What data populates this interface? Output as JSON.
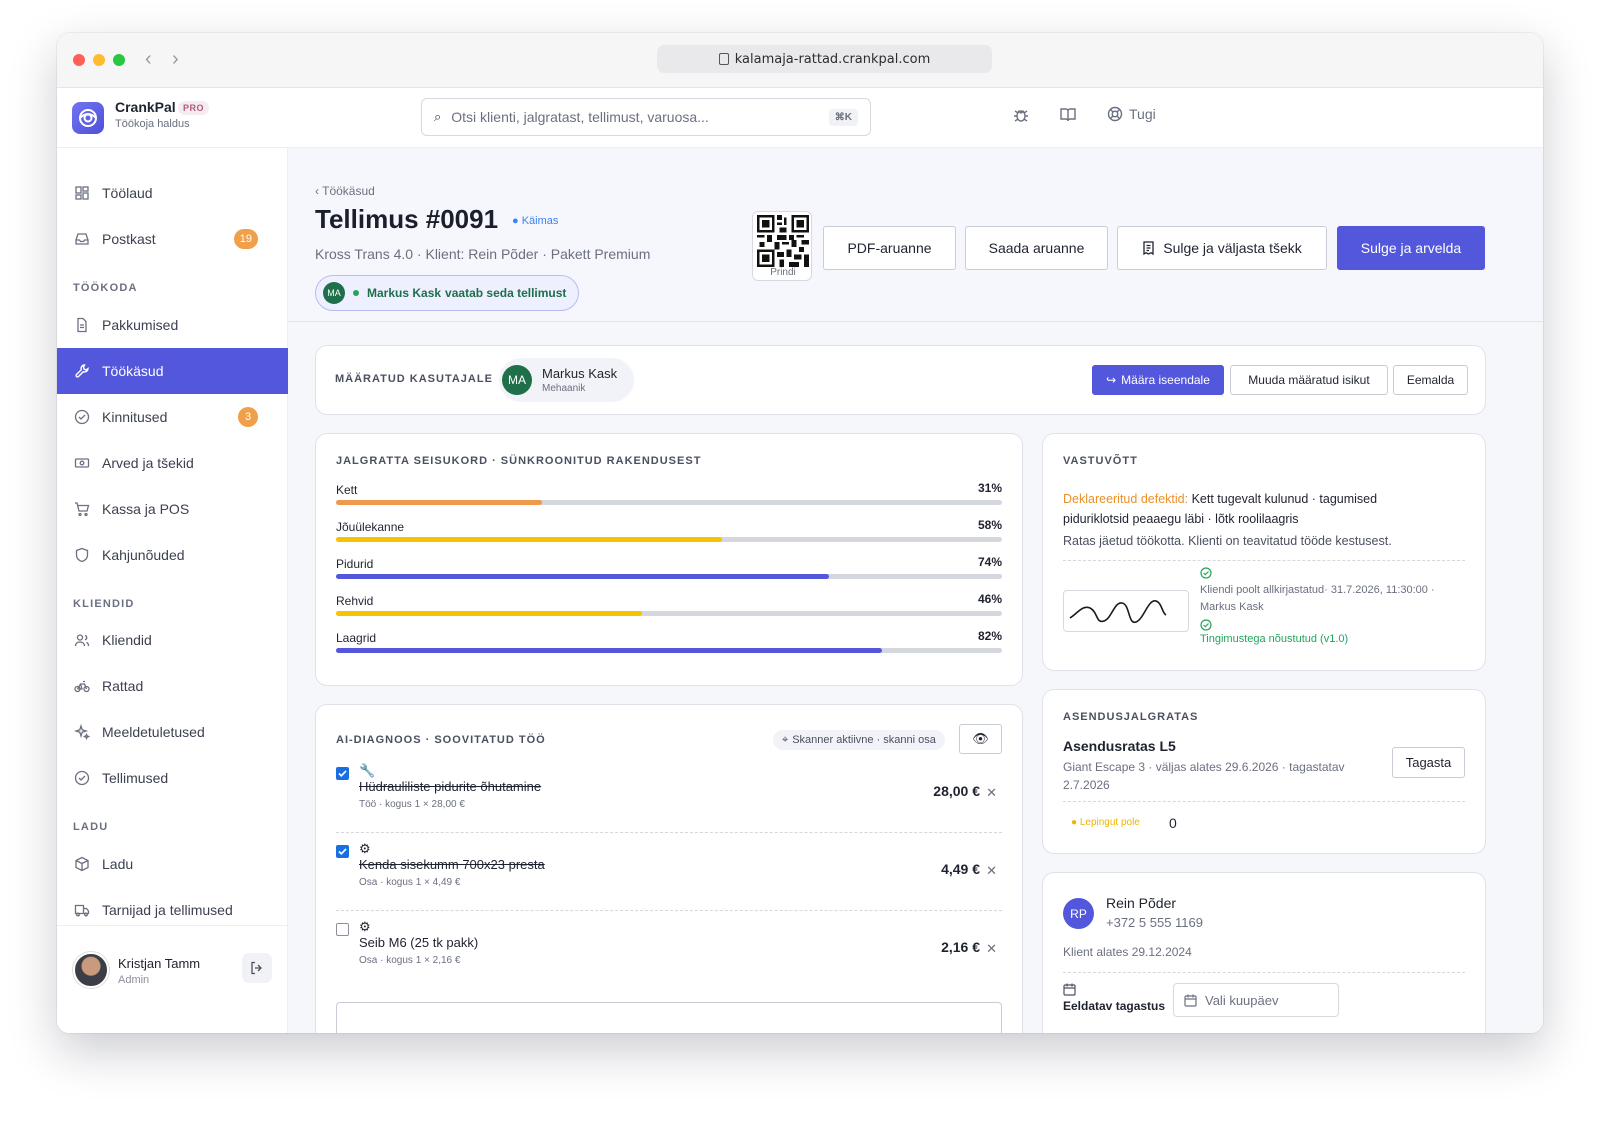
{
  "browser": {
    "url": "kalamaja-rattad.crankpal.com"
  },
  "app": {
    "name": "CrankPal",
    "badge": "PRO",
    "subtitle": "Töökoja haldus"
  },
  "search": {
    "placeholder": "Otsi klienti, jalgratast, tellimust, varuosa...",
    "shortcut": "⌘K"
  },
  "header": {
    "support_label": "Tugi"
  },
  "sidebar": {
    "items_top": [
      {
        "label": "Töölaud",
        "icon": "dashboard-icon"
      },
      {
        "label": "Postkast",
        "icon": "inbox-icon",
        "badge": "19"
      }
    ],
    "section_workshop": "TÖÖKODA",
    "items_workshop": [
      {
        "label": "Pakkumised",
        "icon": "document-icon"
      },
      {
        "label": "Töökäsud",
        "icon": "wrench-icon",
        "active": true
      },
      {
        "label": "Kinnitused",
        "icon": "check-circle-icon",
        "badge": "3"
      },
      {
        "label": "Arved ja tšekid",
        "icon": "cash-icon"
      },
      {
        "label": "Kassa ja POS",
        "icon": "cart-icon"
      },
      {
        "label": "Kahjunõuded",
        "icon": "shield-icon"
      }
    ],
    "section_clients": "KLIENDID",
    "items_clients": [
      {
        "label": "Kliendid",
        "icon": "users-icon"
      },
      {
        "label": "Rattad",
        "icon": "bike-icon"
      },
      {
        "label": "Meeldetuletused",
        "icon": "sparkle-icon"
      },
      {
        "label": "Tellimused",
        "icon": "check-circle-icon"
      }
    ],
    "section_warehouse": "LADU",
    "items_warehouse": [
      {
        "label": "Ladu",
        "icon": "box-icon"
      },
      {
        "label": "Tarnijad ja tellimused",
        "icon": "truck-icon"
      }
    ],
    "user": {
      "name": "Kristjan Tamm",
      "role": "Admin"
    }
  },
  "page": {
    "breadcrumb": "‹ Töökäsud",
    "title": "Tellimus #0091",
    "status": "● Käimas",
    "subtitle": "Kross Trans 4.0 · Klient: Rein Põder · Pakett Premium",
    "viewer": {
      "initials": "MA",
      "name": "Markus Kask",
      "text": "vaatab seda tellimust"
    },
    "qr_label": "Prindi",
    "actions": {
      "pdf": "PDF-aruanne",
      "send": "Saada aruanne",
      "close_receipt": "Sulge ja väljasta tšekk",
      "close_invoice": "Sulge ja arvelda"
    }
  },
  "assigned": {
    "label": "MÄÄRATUD KASUTAJALE",
    "initials": "MA",
    "name": "Markus Kask",
    "role": "Mehaanik",
    "assign_self": "Määra iseendale",
    "change": "Muuda määratud isikut",
    "remove": "Eemalda"
  },
  "condition": {
    "label": "JALGRATTA SEISUKORD · SÜNKROONITUD RAKENDUSEST",
    "bars": [
      {
        "name": "Kett",
        "percent": 31,
        "display": "31%",
        "color": "#ee9a4e"
      },
      {
        "name": "Jõuülekanne",
        "percent": 58,
        "display": "58%",
        "color": "#f5c400"
      },
      {
        "name": "Pidurid",
        "percent": 74,
        "display": "74%",
        "color": "#5357dc"
      },
      {
        "name": "Rehvid",
        "percent": 46,
        "display": "46%",
        "color": "#f5c400"
      },
      {
        "name": "Laagrid",
        "percent": 82,
        "display": "82%",
        "color": "#5357dc"
      }
    ]
  },
  "diagnosis": {
    "label": "AI-DIAGNOOS · SOOVITATUD TÖÖ",
    "scanner": "Skanner aktiivne · skanni osa",
    "items": [
      {
        "checked": true,
        "icon": "wrench-icon",
        "glyph": "🔧",
        "name": "Hüdrauliliste pidurite õhutamine",
        "meta": "Töö · kogus 1 × 28,00 €",
        "price": "28,00 €"
      },
      {
        "checked": true,
        "icon": "gear-icon",
        "glyph": "⚙",
        "name": "Kenda sisekumm 700x23 presta",
        "meta": "Osa · kogus 1 × 4,49 €",
        "price": "4,49 €"
      },
      {
        "checked": false,
        "icon": "gear-icon",
        "glyph": "⚙",
        "name": "Seib M6 (25 tk pakk)",
        "meta": "Osa · kogus 1 × 2,16 €",
        "price": "2,16 €"
      }
    ]
  },
  "intake": {
    "label": "VASTUVÕTT",
    "defects_label": "Deklareeritud defektid:",
    "defects_line1": "Kett tugevalt kulunud · tagumised",
    "defects_line2": "piduriklotsid peaaegu läbi · lõtk roolilaagris",
    "note": "Ratas jäetud töökotta. Klienti on teavitatud tööde kestusest.",
    "signed_line1": "Kliendi poolt allkirjastatud· 31.7.2026, 11:30:00 ·",
    "signed_line2": "Markus Kask",
    "terms": "Tingimustega nõustutud (v1.0)",
    "accent": "#e8912d",
    "ok_color": "#23a55a"
  },
  "loaner": {
    "label": "ASENDUSJALGRATAS",
    "title": "Asendusratas L5",
    "meta_line1": "Giant Escape 3 · väljas alates 29.6.2026 · tagastatav",
    "meta_line2": "2.7.2026",
    "return_button": "Tagasta",
    "contract": "● Lepingut pole",
    "count": "0"
  },
  "customer": {
    "initials": "RP",
    "name": "Rein Põder",
    "phone": "+372 5 555 1169",
    "since": "Klient alates 29.12.2024",
    "due_label": "Eeldatav tagastus",
    "date_placeholder": "Vali kuupäev"
  }
}
